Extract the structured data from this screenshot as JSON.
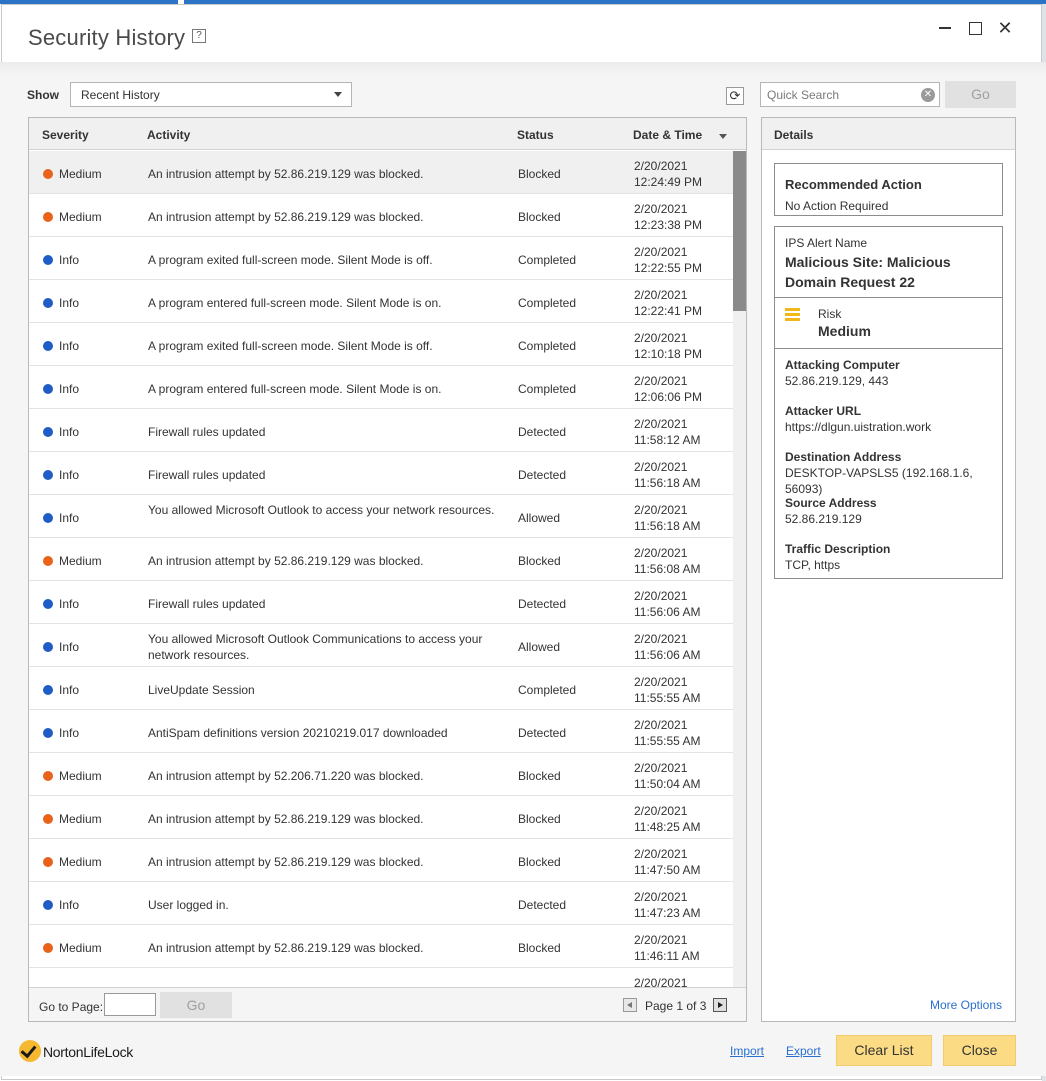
{
  "window": {
    "title": "Security History",
    "help_glyph": "?",
    "controls": {
      "minimize": "—",
      "maximize": "☐",
      "close": "✕"
    }
  },
  "toolbar": {
    "show_label": "Show",
    "show_selected": "Recent History",
    "search_placeholder": "Quick Search",
    "go_label": "Go"
  },
  "table": {
    "columns": [
      "Severity",
      "Activity",
      "Status",
      "Date & Time"
    ],
    "rows": [
      {
        "severity": "Medium",
        "activity": "An intrusion attempt by 52.86.219.129 was blocked.",
        "status": "Blocked",
        "date": "2/20/2021",
        "time": "12:24:49 PM"
      },
      {
        "severity": "Medium",
        "activity": "An intrusion attempt by 52.86.219.129 was blocked.",
        "status": "Blocked",
        "date": "2/20/2021",
        "time": "12:23:38 PM"
      },
      {
        "severity": "Info",
        "activity": "A program exited full-screen mode. Silent Mode is off.",
        "status": "Completed",
        "date": "2/20/2021",
        "time": "12:22:55 PM"
      },
      {
        "severity": "Info",
        "activity": "A program entered full-screen mode. Silent Mode is on.",
        "status": "Completed",
        "date": "2/20/2021",
        "time": "12:22:41 PM"
      },
      {
        "severity": "Info",
        "activity": "A program exited full-screen mode. Silent Mode is off.",
        "status": "Completed",
        "date": "2/20/2021",
        "time": "12:10:18 PM"
      },
      {
        "severity": "Info",
        "activity": "A program entered full-screen mode. Silent Mode is on.",
        "status": "Completed",
        "date": "2/20/2021",
        "time": "12:06:06 PM"
      },
      {
        "severity": "Info",
        "activity": "Firewall rules updated",
        "status": "Detected",
        "date": "2/20/2021",
        "time": "11:58:12 AM"
      },
      {
        "severity": "Info",
        "activity": "Firewall rules updated",
        "status": "Detected",
        "date": "2/20/2021",
        "time": "11:56:18 AM"
      },
      {
        "severity": "Info",
        "activity": "You allowed Microsoft Outlook to access your network resources.",
        "status": "Allowed",
        "date": "2/20/2021",
        "time": "11:56:18 AM"
      },
      {
        "severity": "Medium",
        "activity": "An intrusion attempt by 52.86.219.129 was blocked.",
        "status": "Blocked",
        "date": "2/20/2021",
        "time": "11:56:08 AM"
      },
      {
        "severity": "Info",
        "activity": "Firewall rules updated",
        "status": "Detected",
        "date": "2/20/2021",
        "time": "11:56:06 AM"
      },
      {
        "severity": "Info",
        "activity": "You allowed Microsoft Outlook Communications to access your network resources.",
        "status": "Allowed",
        "date": "2/20/2021",
        "time": "11:56:06 AM"
      },
      {
        "severity": "Info",
        "activity": "LiveUpdate Session",
        "status": "Completed",
        "date": "2/20/2021",
        "time": "11:55:55 AM"
      },
      {
        "severity": "Info",
        "activity": "AntiSpam definitions version 20210219.017 downloaded",
        "status": "Detected",
        "date": "2/20/2021",
        "time": "11:55:55 AM"
      },
      {
        "severity": "Medium",
        "activity": "An intrusion attempt by 52.206.71.220 was blocked.",
        "status": "Blocked",
        "date": "2/20/2021",
        "time": "11:50:04 AM"
      },
      {
        "severity": "Medium",
        "activity": "An intrusion attempt by 52.86.219.129 was blocked.",
        "status": "Blocked",
        "date": "2/20/2021",
        "time": "11:48:25 AM"
      },
      {
        "severity": "Medium",
        "activity": "An intrusion attempt by 52.86.219.129 was blocked.",
        "status": "Blocked",
        "date": "2/20/2021",
        "time": "11:47:50 AM"
      },
      {
        "severity": "Info",
        "activity": "User logged in.",
        "status": "Detected",
        "date": "2/20/2021",
        "time": "11:47:23 AM"
      },
      {
        "severity": "Medium",
        "activity": "An intrusion attempt by 52.86.219.129 was blocked.",
        "status": "Blocked",
        "date": "2/20/2021",
        "time": "11:46:11 AM"
      },
      {
        "severity": "",
        "activity": "",
        "status": "",
        "date": "2/20/2021",
        "time": ""
      }
    ],
    "severity_colors": {
      "Medium": "#e8621a",
      "Info": "#1f5cc4"
    },
    "selected_row": 0
  },
  "pagination": {
    "goto_label": "Go to Page:",
    "go_label": "Go",
    "page_text": "Page 1 of 3"
  },
  "details": {
    "title": "Details",
    "recommended_label": "Recommended Action",
    "recommended_value": "No Action Required",
    "ips_label": "IPS Alert Name",
    "ips_name": "Malicious Site: Malicious Domain Request 22",
    "risk_label": "Risk",
    "risk_value": "Medium",
    "fields": [
      {
        "label": "Attacking Computer",
        "value": "52.86.219.129, 443"
      },
      {
        "label": "Attacker URL",
        "value": "https://dlgun.uistration.work"
      },
      {
        "label": "Destination Address",
        "value": "DESKTOP-VAPSLS5 (192.168.1.6, 56093)"
      },
      {
        "label": "Source Address",
        "value": "52.86.219.129"
      },
      {
        "label": "Traffic Description",
        "value": "TCP, https"
      }
    ],
    "more_options": "More Options"
  },
  "footer": {
    "logo_text": "NortonLifeLock",
    "import_label": "Import",
    "export_label": "Export",
    "clear_label": "Clear List",
    "close_label": "Close"
  }
}
